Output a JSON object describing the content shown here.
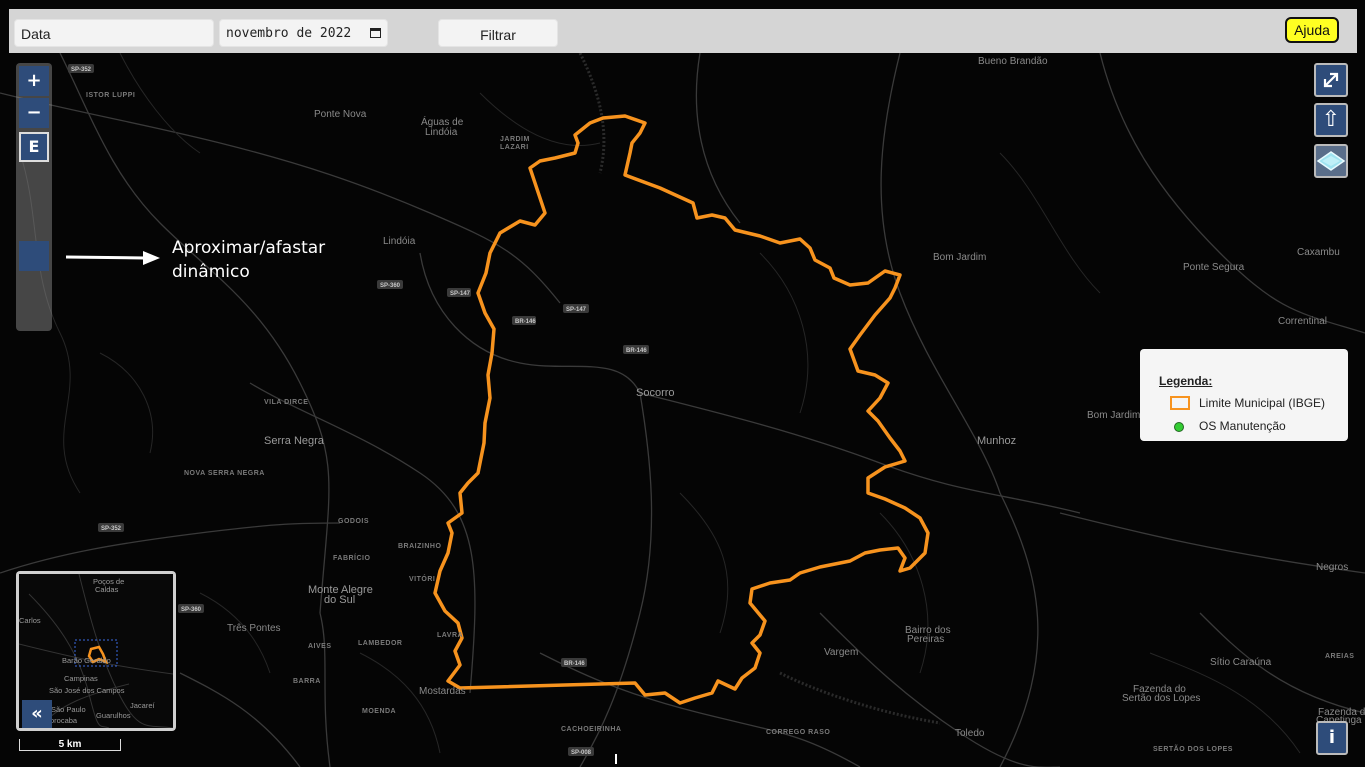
{
  "toolbar": {
    "date_label": "Data",
    "month_value": "novembro de 2022",
    "filter_label": "Filtrar",
    "help_label": "Ajuda"
  },
  "controls": {
    "zoom_in": "+",
    "zoom_out": "−",
    "zoom_extent": "E",
    "home_glyph": "⇧",
    "info_glyph": "i",
    "overview_toggle_glyph": "«"
  },
  "annotation": {
    "line1": "Aproximar/afastar",
    "line2": "dinâmico"
  },
  "legend": {
    "title": "Legenda:",
    "items": [
      "Limite Municipal (IBGE)",
      "OS Manutenção"
    ]
  },
  "scale": {
    "label": "5 km"
  },
  "colors": {
    "boundary": "#f7931e",
    "control_blue": "#2e4c7a",
    "help_yellow": "#ffff22",
    "os_green": "#33cc33"
  },
  "map": {
    "center_label": "Socorro",
    "places": [
      "Bueno Brandão",
      "ISTOR LUPPI",
      "Ponte Nova",
      "Águas de",
      "Lindóia",
      "JARDIM",
      "LAZARI",
      "Lindóia",
      "Bom Jardim",
      "Caxambu",
      "Ponte Segura",
      "Correntinal",
      "VILA DIRCE",
      "Serra Negra",
      "NOVA SERRA NEGRA",
      "Munhoz",
      "Bom Jardim",
      "GODOIS",
      "FABRÍCIO",
      "BRAIZINHO",
      "VITÓRI",
      "Monte Alegre",
      "do Sul",
      "Três Pontes",
      "AIVES",
      "LAMBEDOR",
      "LAVRA",
      "BARRA",
      "Mostardas",
      "MOENDA",
      "Vargem",
      "Bairro dos",
      "Pereiras",
      "Sítio Caraúna",
      "AREIAS",
      "Negros",
      "Fazenda do",
      "Sertão dos Lopes",
      "Fazenda da",
      "Capetinga",
      "CACHOEIRINHA",
      "CORREGO RASO",
      "Toledo",
      "SERTÃO DOS LOPES"
    ],
    "road_shields": [
      "SP-352",
      "SP-360",
      "SP-147",
      "BR-146",
      "SP-147",
      "BR-146",
      "SP-352",
      "SP-360",
      "BR-146",
      "SP-008"
    ]
  },
  "overview": {
    "places": [
      "Poços de",
      "Caldas",
      "Barão Geraldo",
      "Campinas",
      "São José dos Campos",
      "São Paulo",
      "Jacareí",
      "Guarulhos",
      "Sorocaba",
      "Carlos"
    ]
  }
}
